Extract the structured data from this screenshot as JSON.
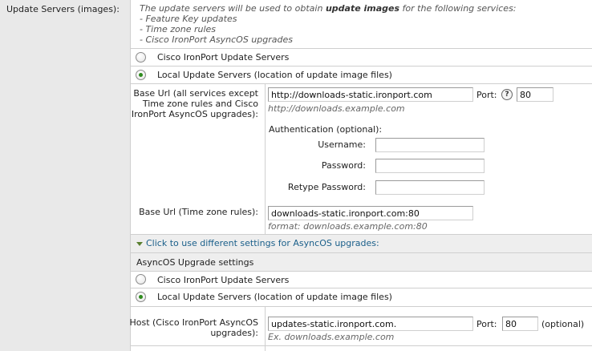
{
  "left": {
    "label": "Update Servers (images):"
  },
  "description": {
    "prefix": "The update servers will be used to obtain ",
    "bold": "update images",
    "suffix": " for the following services:",
    "items": [
      "- Feature Key updates",
      "- Time zone rules",
      "- Cisco IronPort AsyncOS upgrades"
    ]
  },
  "main_choice": {
    "option1": {
      "label": "Cisco IronPort Update Servers",
      "checked": false
    },
    "option2": {
      "label": "Local Update Servers (location of update image files)",
      "checked": true
    }
  },
  "local": {
    "base_url_label": "Base Url (all services except Time zone rules and Cisco IronPort AsyncOS upgrades):",
    "base_url_value": "http://downloads-static.ironport.com",
    "base_url_hint": "http://downloads.example.com",
    "port_label": "Port:",
    "help_icon": "?",
    "port_value": "80",
    "auth_label": "Authentication (optional):",
    "username_label": "Username:",
    "username_value": "",
    "password_label": "Password:",
    "password_value": "",
    "retype_label": "Retype Password:",
    "retype_value": "",
    "tz_label": "Base Url (Time zone rules):",
    "tz_value": "downloads-static.ironport.com:80",
    "tz_hint": "format: downloads.example.com:80"
  },
  "toggle": {
    "label": "Click to use different settings for AsyncOS upgrades:"
  },
  "asyncos": {
    "heading": "AsyncOS Upgrade settings",
    "option1": {
      "label": "Cisco IronPort Update Servers",
      "checked": false
    },
    "option2": {
      "label": "Local Update Servers (location of update image files)",
      "checked": true
    },
    "host_label": "Host (Cisco IronPort AsyncOS upgrades):",
    "host_value": "updates-static.ironport.com.",
    "host_hint": "Ex. downloads.example.com",
    "port_label": "Port:",
    "port_value": "80",
    "optional": "(optional)"
  },
  "colors": {
    "left_bg": "#e9e9e9",
    "section_bg": "#eeeeee",
    "radio_selected": "#2e8b1e",
    "link": "#1a5f8a"
  }
}
